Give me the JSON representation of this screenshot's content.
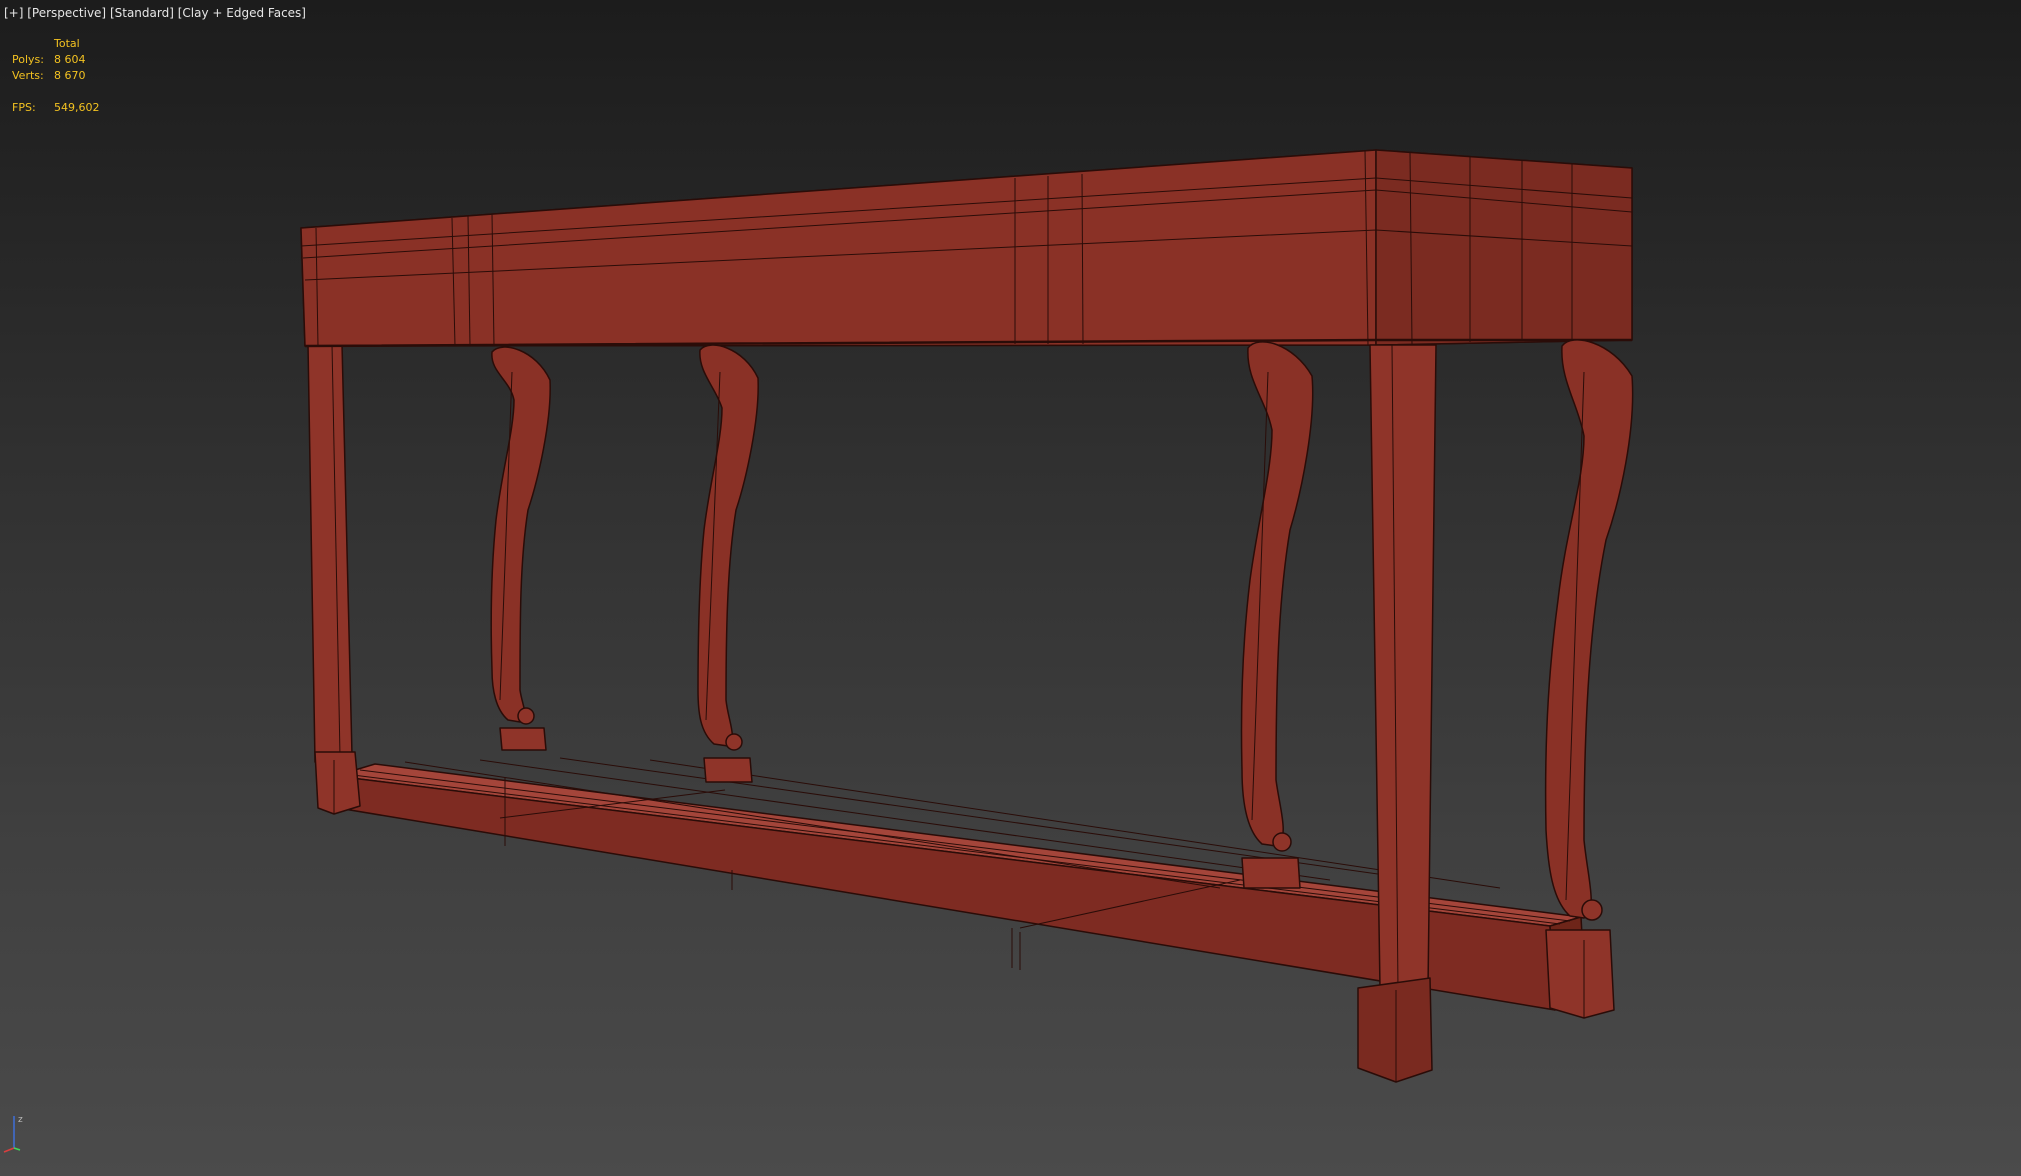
{
  "viewport": {
    "labels": [
      "[+]",
      "[Perspective]",
      "[Standard]",
      "[Clay + Edged Faces]"
    ],
    "stats": {
      "header": "Total",
      "polys_label": "Polys:",
      "polys_value": "8 604",
      "verts_label": "Verts:",
      "verts_value": "8 670",
      "fps_label": "FPS:",
      "fps_value": "549,602"
    },
    "axis_label": "z"
  },
  "colors": {
    "stats_text": "#f3c221",
    "model_clay": "#8f3429",
    "model_edges": "#2a0c08"
  }
}
